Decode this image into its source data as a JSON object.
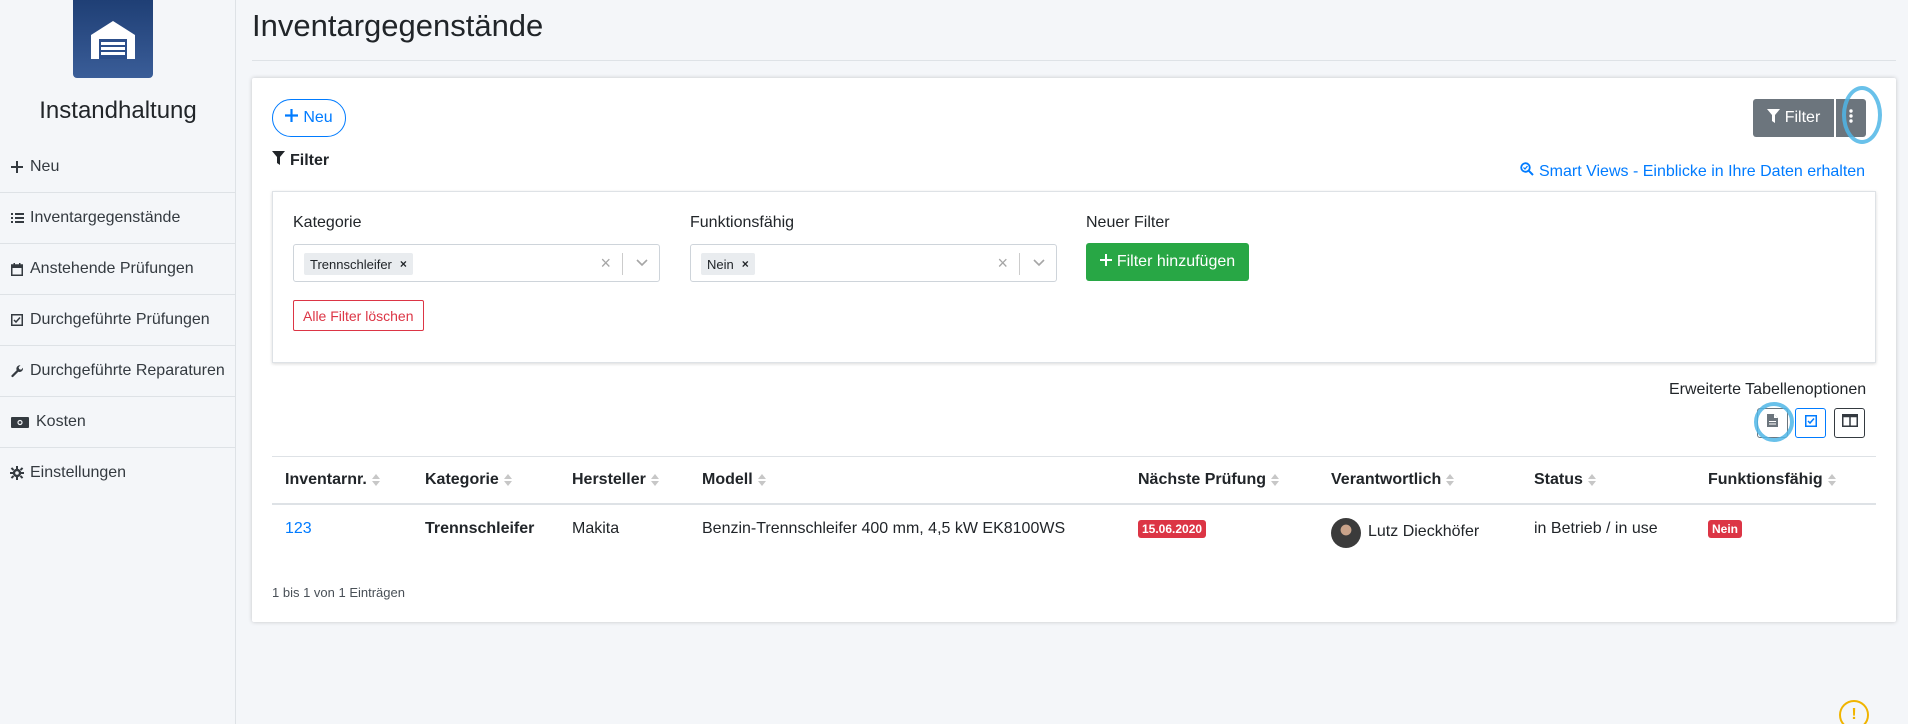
{
  "app": {
    "title": "Instandhaltung"
  },
  "sidebar": {
    "items": [
      {
        "label": "Neu",
        "icon": "plus-icon"
      },
      {
        "label": "Inventargegenstände",
        "icon": "list-icon"
      },
      {
        "label": "Anstehende Prüfungen",
        "icon": "calendar-icon"
      },
      {
        "label": "Durchgeführte Prüfungen",
        "icon": "check-square-icon"
      },
      {
        "label": "Durchgeführte Reparaturen",
        "icon": "wrench-icon"
      },
      {
        "label": "Kosten",
        "icon": "money-icon"
      },
      {
        "label": "Einstellungen",
        "icon": "gear-icon"
      }
    ]
  },
  "header": {
    "title": "Inventargegenstände"
  },
  "toolbar": {
    "new_label": "Neu",
    "filter_label": "Filter",
    "filter_button_label": "Filter"
  },
  "smart_views": {
    "label": "Smart Views - Einblicke in Ihre Daten erhalten"
  },
  "filters": {
    "kategorie": {
      "label": "Kategorie",
      "chip": "Trennschleifer"
    },
    "funktionsfaehig": {
      "label": "Funktionsfähig",
      "chip": "Nein"
    },
    "neuer_filter": {
      "label": "Neuer Filter",
      "button": "Filter hinzufügen"
    },
    "clear_all": "Alle Filter löschen"
  },
  "table_options": {
    "label": "Erweiterte Tabellenoptionen"
  },
  "table": {
    "headers": [
      "Inventarnr.",
      "Kategorie",
      "Hersteller",
      "Modell",
      "Nächste Prüfung",
      "Verantwortlich",
      "Status",
      "Funktionsfähig"
    ],
    "rows": [
      {
        "inventarnr": "123",
        "kategorie": "Trennschleifer",
        "hersteller": "Makita",
        "modell": "Benzin-Trennschleifer 400 mm, 4,5 kW EK8100WS",
        "naechste_pruefung": "15.06.2020",
        "verantwortlich": "Lutz Dieckhöfer",
        "status": "in Betrieb / in use",
        "funktionsfaehig": "Nein"
      }
    ],
    "count_text": "1 bis 1 von 1 Einträgen"
  },
  "colors": {
    "primary": "#007bff",
    "success": "#28a745",
    "danger": "#dc3545",
    "secondary": "#6c757d",
    "highlight": "#4fb6e6"
  }
}
